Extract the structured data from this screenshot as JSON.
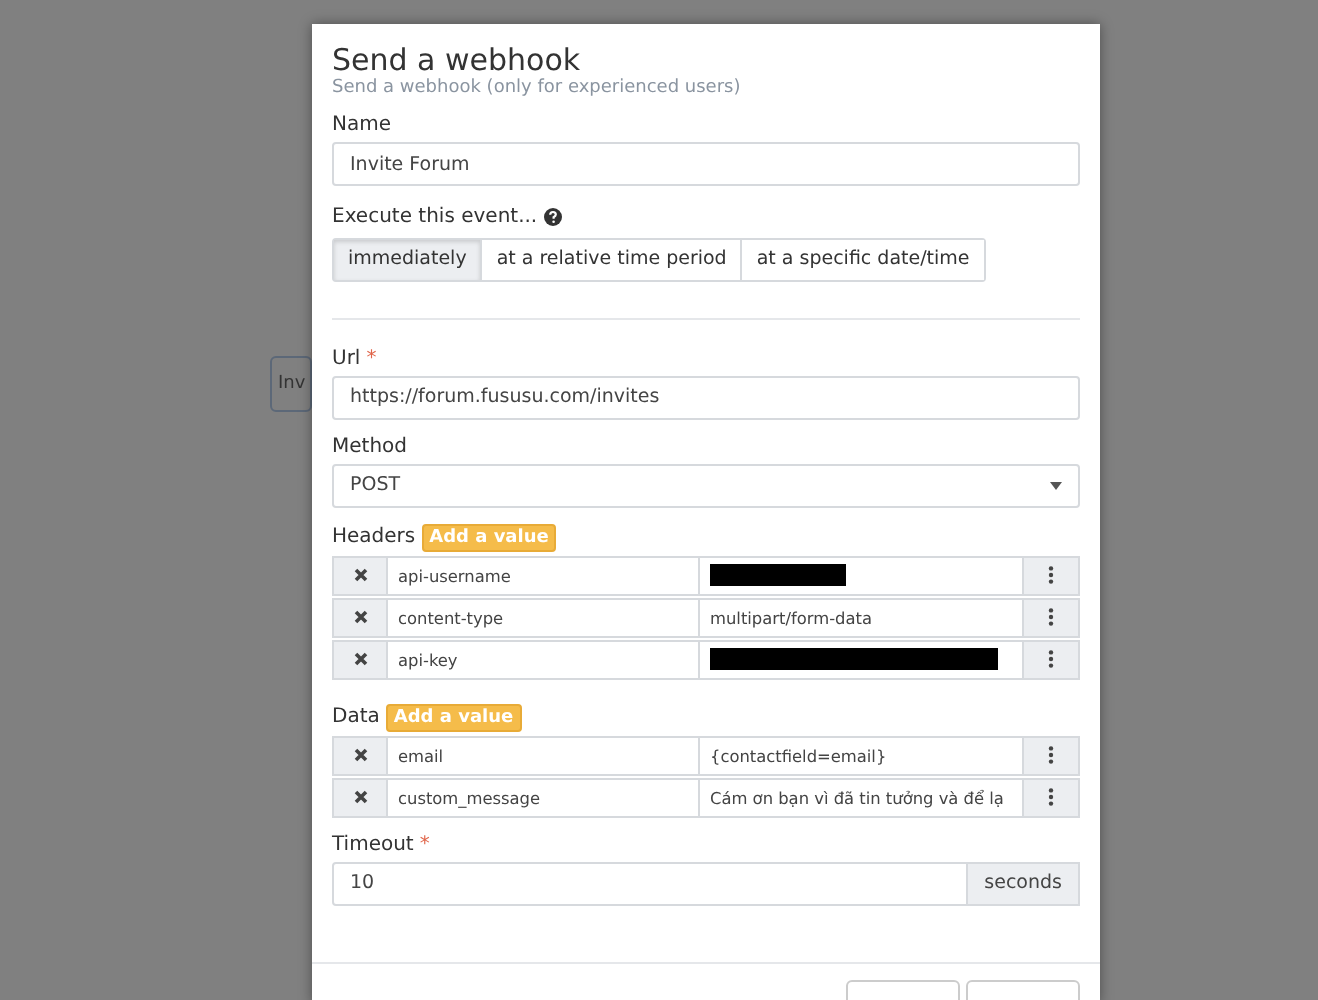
{
  "canvas_node": {
    "label": "Inv"
  },
  "modal": {
    "title": "Send a webhook",
    "subtitle": "Send a webhook (only for experienced users)",
    "name_field": {
      "label": "Name",
      "value": "Invite Forum"
    },
    "execute": {
      "label": "Execute this event...",
      "options": [
        {
          "label": "immediately",
          "selected": true
        },
        {
          "label": "at a relative time period",
          "selected": false
        },
        {
          "label": "at a specific date/time",
          "selected": false
        }
      ]
    },
    "url_field": {
      "label": "Url",
      "required_mark": "*",
      "value": "https://forum.fususu.com/invites"
    },
    "method_field": {
      "label": "Method",
      "value": "POST"
    },
    "headers": {
      "label": "Headers",
      "add_button": "Add a value",
      "rows": [
        {
          "key": "api-username",
          "kind": "redacted_short"
        },
        {
          "key": "content-type",
          "kind": "text",
          "value": "multipart/form-data"
        },
        {
          "key": "api-key",
          "kind": "redacted_long"
        }
      ]
    },
    "data": {
      "label": "Data",
      "add_button": "Add a value",
      "rows": [
        {
          "key": "email",
          "kind": "text",
          "value": "{contactfield=email}"
        },
        {
          "key": "custom_message",
          "kind": "text",
          "value": "Cám ơn bạn vì đã tin tưởng và để lạ"
        }
      ]
    },
    "timeout_field": {
      "label": "Timeout",
      "required_mark": "*",
      "value": "10",
      "addon": "seconds"
    }
  }
}
